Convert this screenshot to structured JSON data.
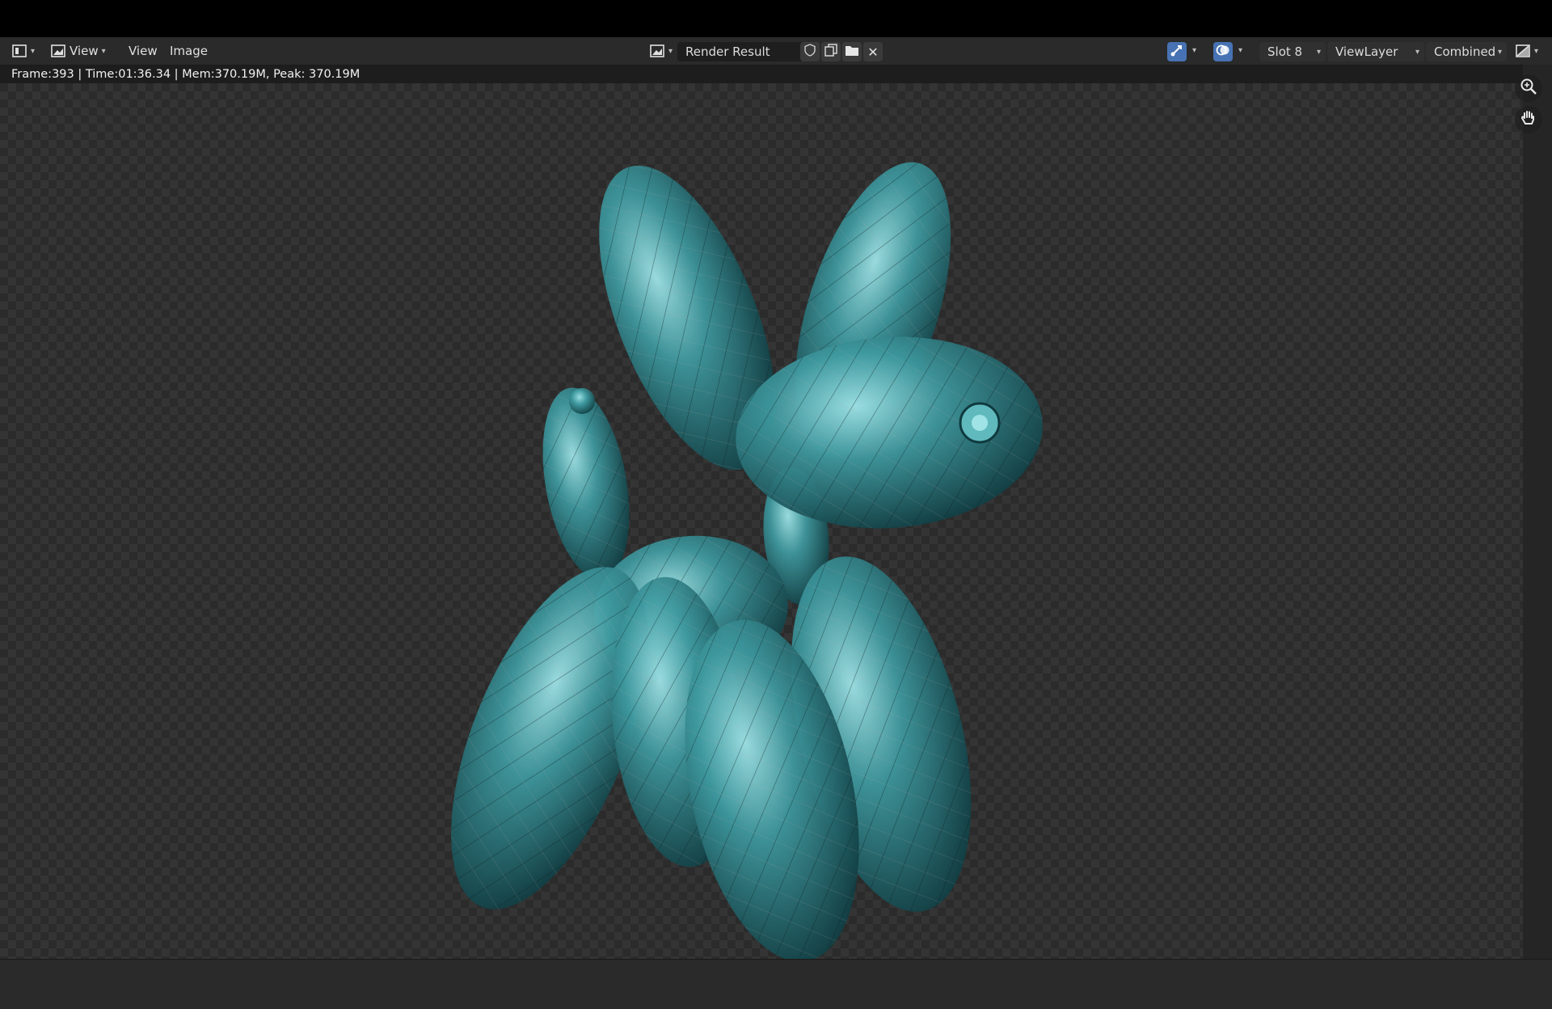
{
  "header": {
    "view_menu": "View",
    "image_menu": "Image",
    "view_mode_label": "View",
    "image_name": "Render Result",
    "slot": "Slot 8",
    "view_layer": "ViewLayer",
    "pass": "Combined"
  },
  "status": {
    "frame_info": "Frame:393 | Time:01:36.34 | Mem:370.19M, Peak: 370.19M"
  },
  "icons": {
    "editor_type": "image-editor-icon",
    "view_mode": "image-view-icon",
    "browse": "image-browse-icon",
    "fake_user": "shield-icon",
    "duplicate": "duplicate-icon",
    "open": "folder-icon",
    "unlink": "close-icon",
    "gizmo": "gizmo-icon",
    "overlay": "overlay-icon",
    "display_channels": "display-channels-icon",
    "zoom": "zoom-icon",
    "pan": "hand-icon"
  },
  "colors": {
    "accent": "#4772b3",
    "render_primary": "#2f7f86",
    "render_highlight": "#9fe3e6"
  }
}
